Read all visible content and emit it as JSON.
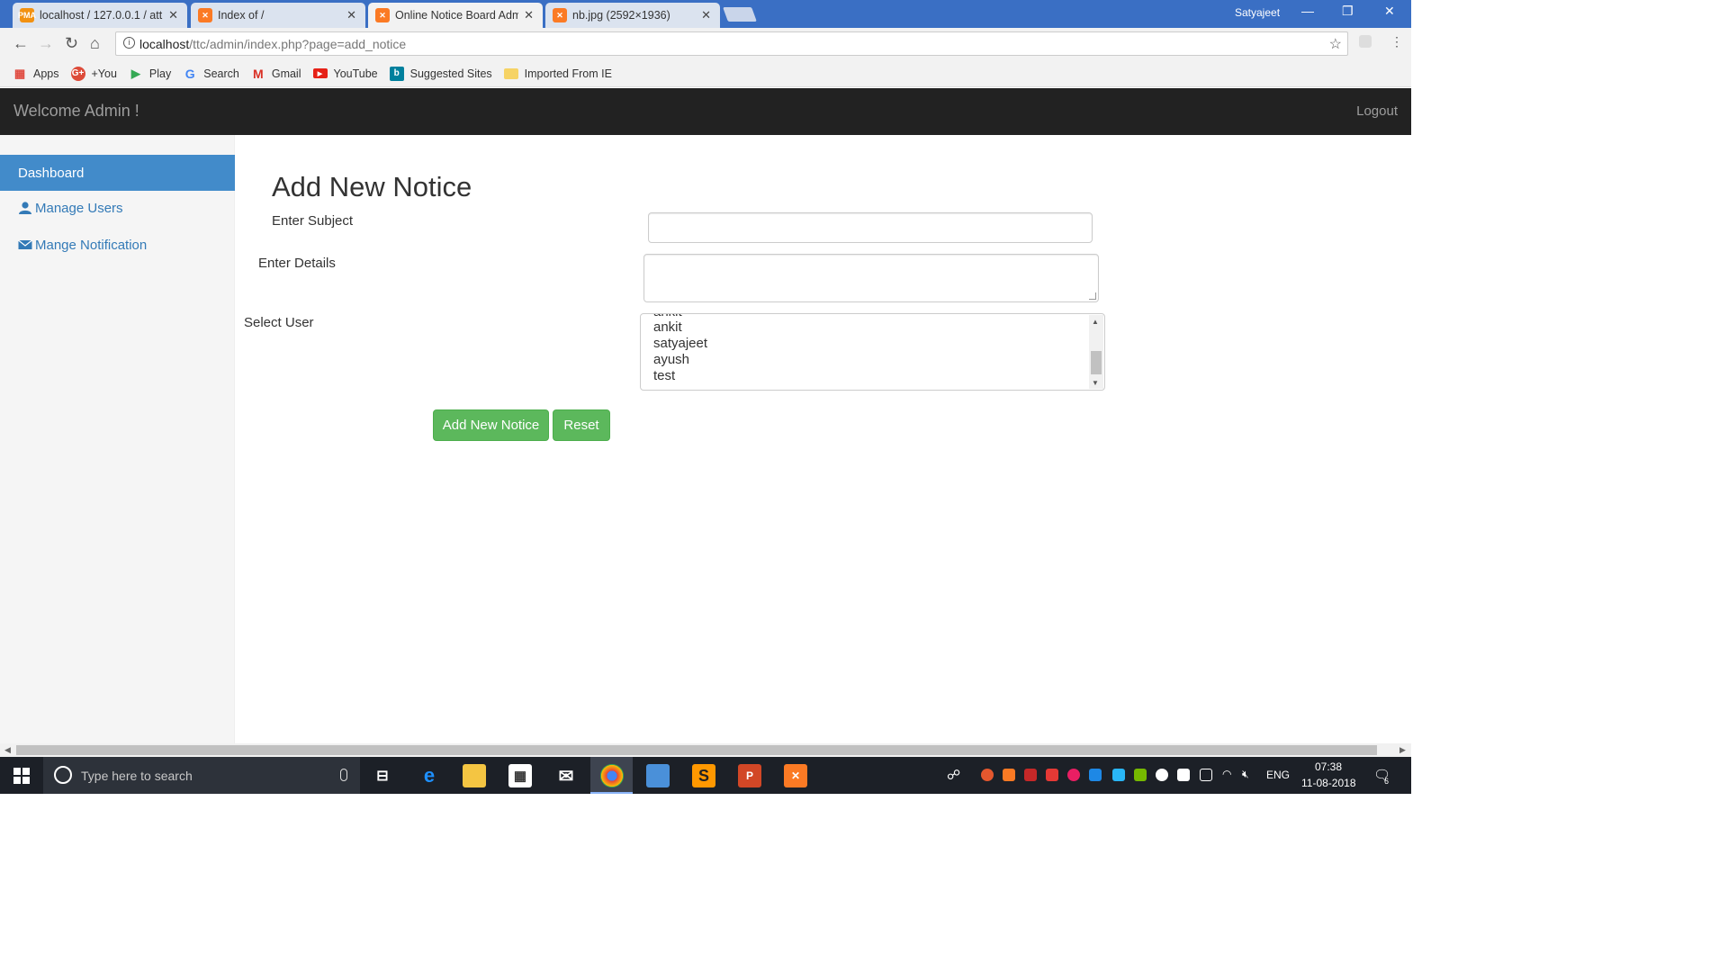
{
  "browser": {
    "tabs": [
      {
        "label": "localhost / 127.0.0.1 / att",
        "icon": "phpmyadmin-icon",
        "color": "#f29111"
      },
      {
        "label": "Index of /",
        "icon": "xampp-icon",
        "color": "#fb7a24"
      },
      {
        "label": "Online Notice Board Adm",
        "icon": "xampp-icon",
        "color": "#fb7a24",
        "active": true
      },
      {
        "label": "nb.jpg (2592×1936)",
        "icon": "xampp-icon",
        "color": "#fb7a24"
      }
    ],
    "profile_name": "Satyajeet",
    "url_host": "localhost",
    "url_path": "/ttc/admin/index.php?page=add_notice",
    "bookmarks": [
      {
        "label": "Apps",
        "icon": "apps-grid-icon"
      },
      {
        "label": "+You",
        "icon": "google-plus-icon"
      },
      {
        "label": "Play",
        "icon": "play-store-icon"
      },
      {
        "label": "Search",
        "icon": "google-icon"
      },
      {
        "label": "Gmail",
        "icon": "gmail-icon"
      },
      {
        "label": "YouTube",
        "icon": "youtube-icon"
      },
      {
        "label": "Suggested Sites",
        "icon": "bing-icon"
      },
      {
        "label": "Imported From IE",
        "icon": "folder-icon"
      }
    ]
  },
  "app": {
    "brand": "Welcome Admin !",
    "logout": "Logout",
    "sidebar": [
      {
        "label": "Dashboard",
        "active": true
      },
      {
        "label": "Manage Users",
        "icon": "user-icon"
      },
      {
        "label": "Mange Notification",
        "icon": "envelope-icon"
      }
    ]
  },
  "form": {
    "title": "Add New Notice",
    "subject_label": "Enter Subject",
    "subject_value": "",
    "details_label": "Enter Details",
    "details_value": "",
    "user_label": "Select User",
    "users": [
      "ankit",
      "ankit",
      "satyajeet",
      "ayush",
      "test"
    ],
    "submit_label": "Add New Notice",
    "reset_label": "Reset"
  },
  "taskbar": {
    "search_placeholder": "Type here to search",
    "language": "ENG",
    "time": "07:38",
    "date": "11-08-2018",
    "notification_count": "6"
  },
  "colors": {
    "accent": "#428bca",
    "success": "#5cb85c",
    "navbar": "#222222",
    "tabstrip": "#3a6fc4"
  }
}
